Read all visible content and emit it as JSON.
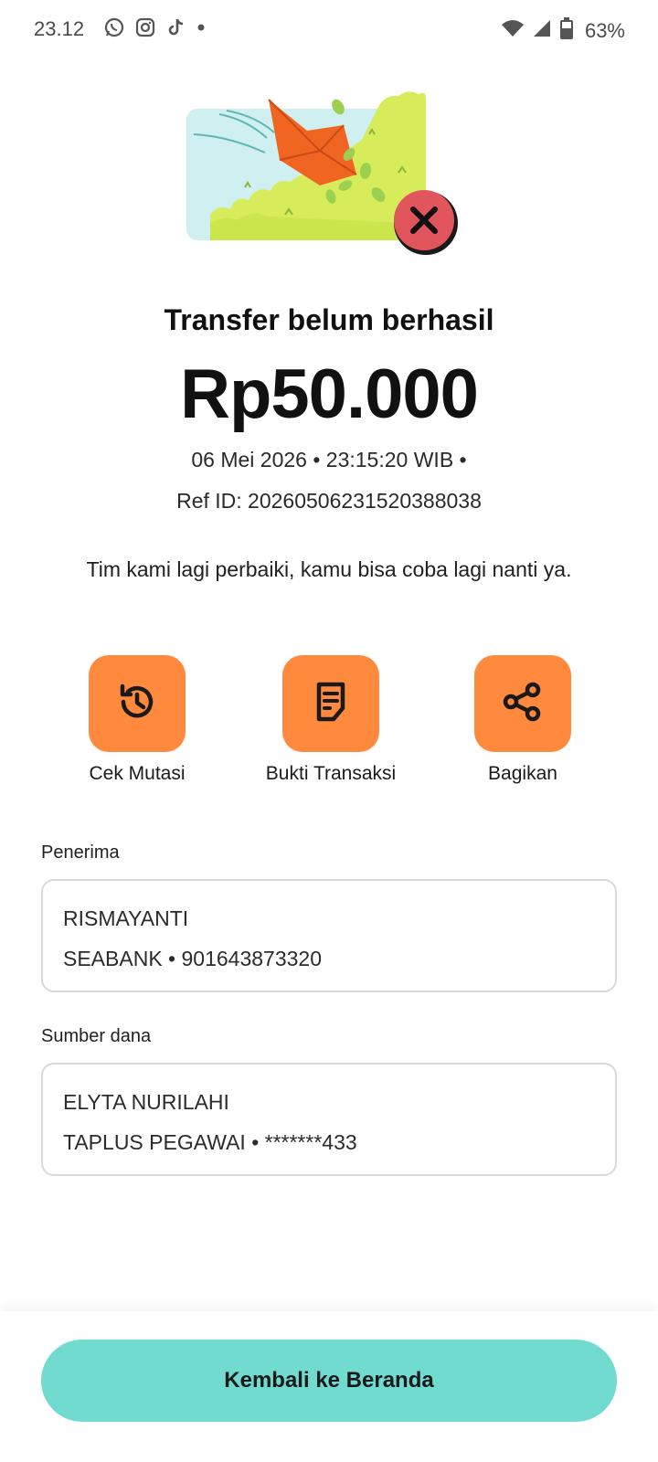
{
  "status_bar": {
    "time": "23.12",
    "battery_percent": "63%",
    "icons": [
      "whatsapp-icon",
      "instagram-icon",
      "tiktok-icon",
      "dot-icon",
      "wifi-icon",
      "signal-icon",
      "battery-icon"
    ]
  },
  "hero": {
    "status_icon": "error-x-icon",
    "accent_color": "#e1565d"
  },
  "result": {
    "title": "Transfer belum berhasil",
    "amount": "Rp50.000",
    "datetime": "06 Mei 2026 • 23:15:20 WIB •",
    "ref_id": "Ref ID: 20260506231520388038",
    "message": "Tim kami lagi perbaiki, kamu bisa coba lagi nanti ya."
  },
  "actions": [
    {
      "label": "Cek Mutasi",
      "icon": "history-icon"
    },
    {
      "label": "Bukti Transaksi",
      "icon": "receipt-icon"
    },
    {
      "label": "Bagikan",
      "icon": "share-icon"
    }
  ],
  "recipient": {
    "section_label": "Penerima",
    "name": "RISMAYANTI",
    "account": "SEABANK • 901643873320"
  },
  "source": {
    "section_label": "Sumber dana",
    "name": "ELYTA NURILAHI",
    "account": "TAPLUS PEGAWAI • *******433"
  },
  "footer": {
    "home_button_label": "Kembali ke Beranda"
  },
  "colors": {
    "action_tile": "#ff8a3d",
    "primary_button": "#72dbcf",
    "card_border": "#d9d9d9"
  }
}
